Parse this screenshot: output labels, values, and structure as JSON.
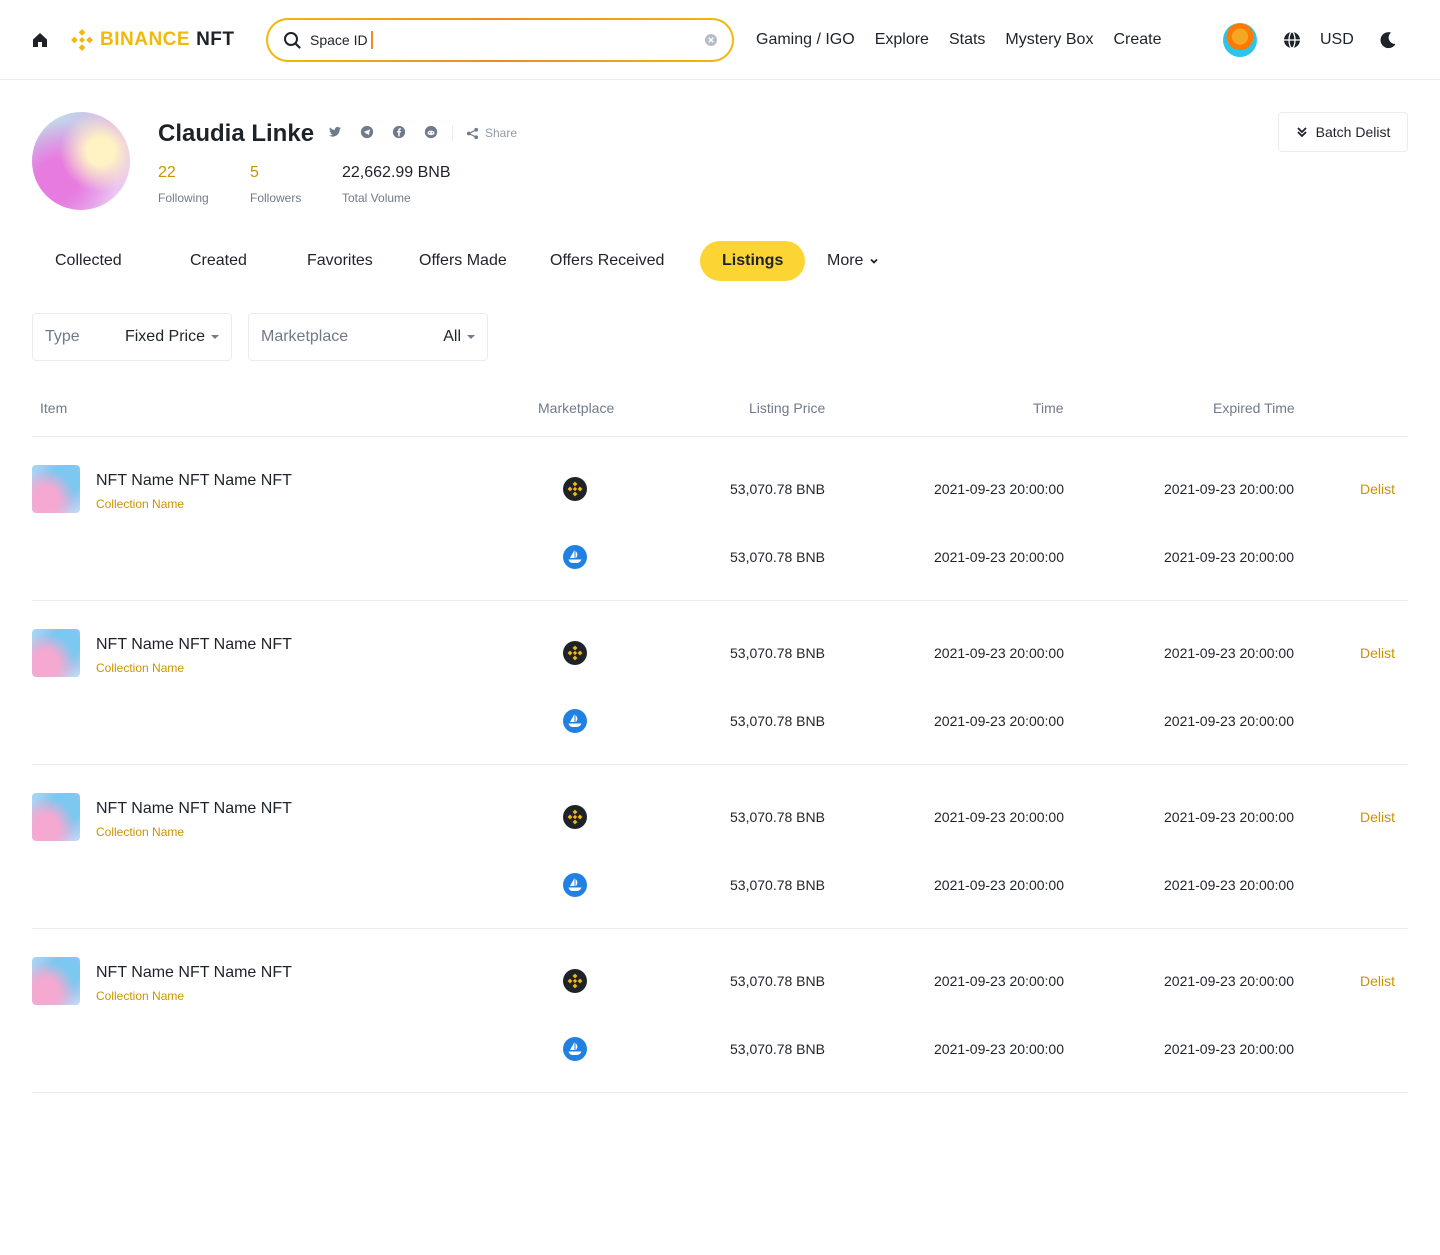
{
  "header": {
    "logo_brand": "BINANCE",
    "logo_product": "NFT",
    "search_value": "Space ID",
    "nav": [
      "Gaming / IGO",
      "Explore",
      "Stats",
      "Mystery Box",
      "Create"
    ],
    "currency": "USD"
  },
  "profile": {
    "name": "Claudia Linke",
    "share_label": "Share",
    "following_count": "22",
    "following_label": "Following",
    "followers_count": "5",
    "followers_label": "Followers",
    "volume": "22,662.99 BNB",
    "volume_label": "Total Volume",
    "batch_delist_label": "Batch Delist",
    "socials": [
      "twitter-icon",
      "telegram-icon",
      "facebook-icon",
      "reddit-icon"
    ]
  },
  "tabs": [
    {
      "label": "Collected",
      "active": false
    },
    {
      "label": "Created",
      "active": false
    },
    {
      "label": "Favorites",
      "active": false
    },
    {
      "label": "Offers Made",
      "active": false
    },
    {
      "label": "Offers Received",
      "active": false
    },
    {
      "label": "Listings",
      "active": true
    },
    {
      "label": "More",
      "active": false
    }
  ],
  "filters": {
    "type_label": "Type",
    "type_value": "Fixed Price",
    "marketplace_label": "Marketplace",
    "marketplace_value": "All"
  },
  "table": {
    "headers": [
      "Item",
      "Marketplace",
      "Listing Price",
      "Time",
      "Expired Time"
    ],
    "delist_label": "Delist",
    "rows": [
      {
        "name": "NFT Name NFT Name NFT",
        "collection": "Collection Name",
        "listings": [
          {
            "marketplace": "binance-marketplace-icon",
            "price": "53,070.78 BNB",
            "time": "2021-09-23 20:00:00",
            "expired": "2021-09-23 20:00:00"
          },
          {
            "marketplace": "opensea-marketplace-icon",
            "price": "53,070.78 BNB",
            "time": "2021-09-23 20:00:00",
            "expired": "2021-09-23 20:00:00"
          }
        ]
      },
      {
        "name": "NFT Name NFT Name NFT",
        "collection": "Collection Name",
        "listings": [
          {
            "marketplace": "binance-marketplace-icon",
            "price": "53,070.78 BNB",
            "time": "2021-09-23 20:00:00",
            "expired": "2021-09-23 20:00:00"
          },
          {
            "marketplace": "opensea-marketplace-icon",
            "price": "53,070.78 BNB",
            "time": "2021-09-23 20:00:00",
            "expired": "2021-09-23 20:00:00"
          }
        ]
      },
      {
        "name": "NFT Name NFT Name NFT",
        "collection": "Collection Name",
        "listings": [
          {
            "marketplace": "binance-marketplace-icon",
            "price": "53,070.78 BNB",
            "time": "2021-09-23 20:00:00",
            "expired": "2021-09-23 20:00:00"
          },
          {
            "marketplace": "opensea-marketplace-icon",
            "price": "53,070.78 BNB",
            "time": "2021-09-23 20:00:00",
            "expired": "2021-09-23 20:00:00"
          }
        ]
      },
      {
        "name": "NFT Name NFT Name NFT",
        "collection": "Collection Name",
        "listings": [
          {
            "marketplace": "binance-marketplace-icon",
            "price": "53,070.78 BNB",
            "time": "2021-09-23 20:00:00",
            "expired": "2021-09-23 20:00:00"
          },
          {
            "marketplace": "opensea-marketplace-icon",
            "price": "53,070.78 BNB",
            "time": "2021-09-23 20:00:00",
            "expired": "2021-09-23 20:00:00"
          }
        ]
      }
    ]
  },
  "colors": {
    "accent": "#f0b90b",
    "tab_active": "#fcd535",
    "link": "#c99400",
    "opensea": "#2081e2"
  }
}
